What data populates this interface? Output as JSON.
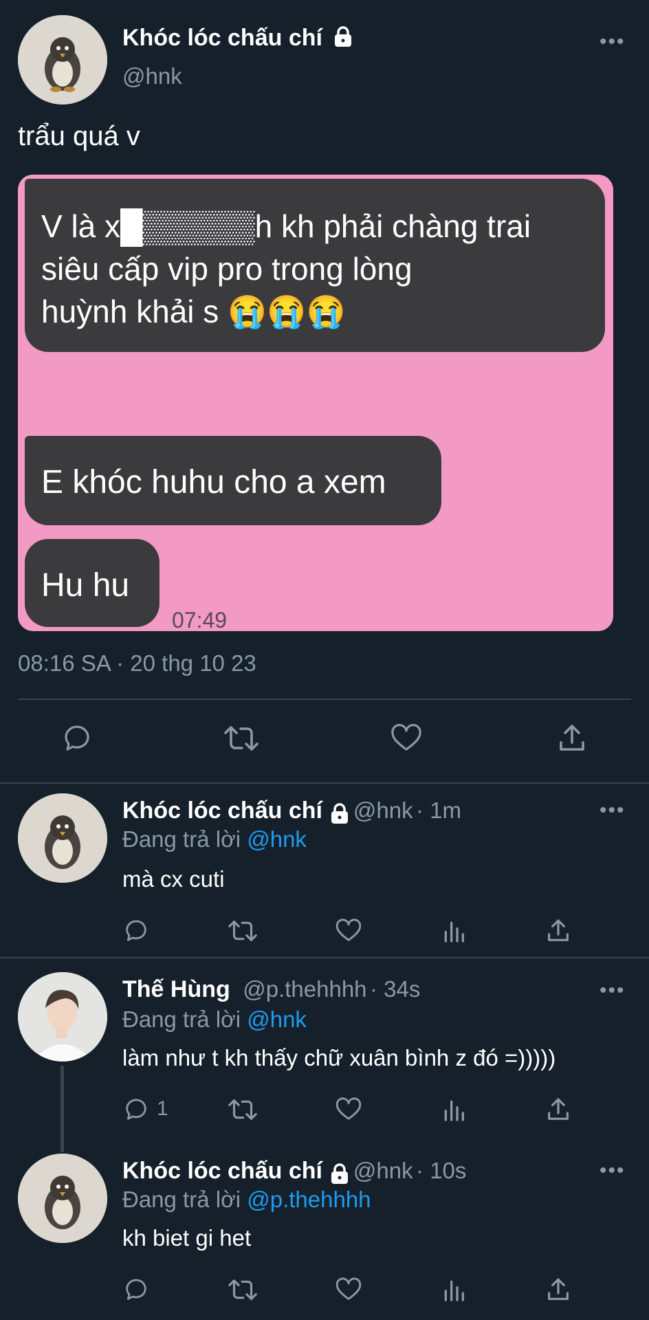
{
  "main_tweet": {
    "name": "Khóc lóc chấu chí",
    "handle": "@hnk",
    "text": "trẩu quá v",
    "timestamp": "08:16 SA · 20 thg 10 23",
    "image": {
      "bubble1_lines": [
        "V là x█▒▒▒▒▒h kh phải chàng trai",
        "siêu cấp vip pro trong lòng",
        "huỳnh khải s 😭😭😭"
      ],
      "bubble2": "E khóc huhu cho a xem",
      "bubble3": "Hu hu",
      "time": "07:49"
    },
    "actions": [
      "reply-icon",
      "retweet-icon",
      "like-icon",
      "share-icon"
    ]
  },
  "replies": [
    {
      "name": "Khóc lóc chấu chí",
      "handle": "@hnk",
      "time": "· 1m",
      "replying_prefix": "Đang trả lời",
      "replying_to": "@hnk",
      "text": "mà cx cuti",
      "reply_count": ""
    },
    {
      "name": "Thế Hùng",
      "handle": "@p.thehhhh",
      "time": "· 34s",
      "replying_prefix": "Đang trả lời",
      "replying_to": "@hnk",
      "text": "làm như t kh thấy chữ xuân bình z đó =)))))",
      "reply_count": "1"
    },
    {
      "name": "Khóc lóc chấu chí",
      "handle": "@hnk",
      "time": "· 10s",
      "replying_prefix": "Đang trả lời",
      "replying_to": "@p.thehhhh",
      "text": "kh biet gi het",
      "reply_count": ""
    }
  ],
  "more_glyph": "•••",
  "colors": {
    "background": "#15202b",
    "secondary_text": "#8b98a5",
    "link": "#1d9bf0",
    "divider": "#38444d",
    "image_bg": "#f29ac4",
    "bubble": "#3b3b3d"
  }
}
